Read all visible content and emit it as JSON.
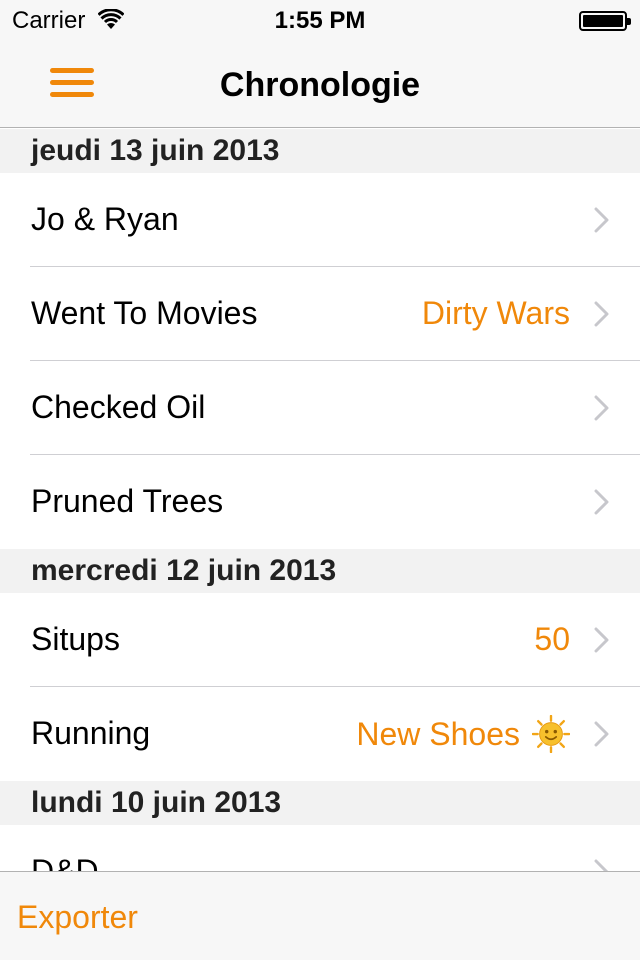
{
  "status_bar": {
    "carrier": "Carrier",
    "time": "1:55 PM"
  },
  "nav_bar": {
    "title": "Chronologie"
  },
  "sections": [
    {
      "header": "jeudi 13 juin 2013",
      "rows": [
        {
          "title": "Jo & Ryan",
          "detail": ""
        },
        {
          "title": "Went To Movies",
          "detail": "Dirty Wars"
        },
        {
          "title": "Checked Oil",
          "detail": ""
        },
        {
          "title": "Pruned Trees",
          "detail": ""
        }
      ]
    },
    {
      "header": "mercredi 12 juin 2013",
      "rows": [
        {
          "title": "Situps",
          "detail": "50"
        },
        {
          "title": "Running",
          "detail": "New Shoes",
          "icon": "sun-face-emoji"
        }
      ]
    },
    {
      "header": "lundi 10 juin 2013",
      "rows": [
        {
          "title": "D&D",
          "detail": ""
        }
      ]
    }
  ],
  "toolbar": {
    "export_label": "Exporter"
  },
  "colors": {
    "accent": "#f0880a",
    "section_bg": "#f2f2f2",
    "bar_bg": "#f7f7f7"
  }
}
